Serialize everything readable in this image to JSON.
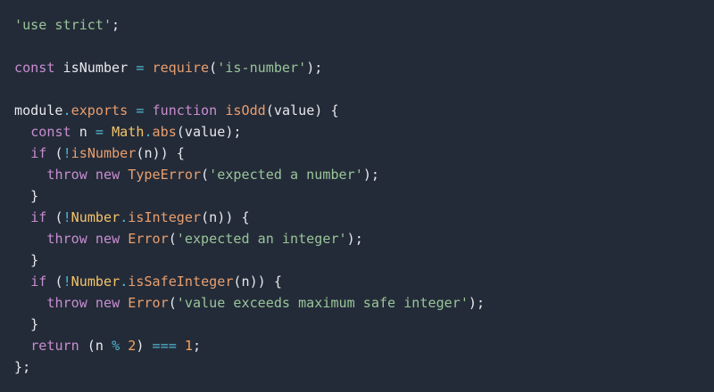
{
  "editor": {
    "colors": {
      "background": "#242b38",
      "plain": "#e6e8ec",
      "keyword": "#c78dd1",
      "string": "#98c59a",
      "function": "#e99f6e",
      "class": "#f2c46b",
      "operator": "#4fb6d2",
      "number": "#f2a35e",
      "property": "#e99f6e"
    },
    "lines": [
      [
        {
          "t": "str",
          "v": "'use strict'"
        },
        {
          "t": "plain",
          "v": ";"
        }
      ],
      [],
      [
        {
          "t": "kw",
          "v": "const"
        },
        {
          "t": "plain",
          "v": " isNumber "
        },
        {
          "t": "op",
          "v": "="
        },
        {
          "t": "plain",
          "v": " "
        },
        {
          "t": "fn",
          "v": "require"
        },
        {
          "t": "plain",
          "v": "("
        },
        {
          "t": "str",
          "v": "'is-number'"
        },
        {
          "t": "plain",
          "v": ");"
        }
      ],
      [],
      [
        {
          "t": "plain",
          "v": "module"
        },
        {
          "t": "op",
          "v": "."
        },
        {
          "t": "prop",
          "v": "exports"
        },
        {
          "t": "plain",
          "v": " "
        },
        {
          "t": "op",
          "v": "="
        },
        {
          "t": "plain",
          "v": " "
        },
        {
          "t": "kw",
          "v": "function"
        },
        {
          "t": "plain",
          "v": " "
        },
        {
          "t": "fn",
          "v": "isOdd"
        },
        {
          "t": "plain",
          "v": "(value) {"
        }
      ],
      [
        {
          "t": "plain",
          "v": "  "
        },
        {
          "t": "kw",
          "v": "const"
        },
        {
          "t": "plain",
          "v": " n "
        },
        {
          "t": "op",
          "v": "="
        },
        {
          "t": "plain",
          "v": " "
        },
        {
          "t": "cls",
          "v": "Math"
        },
        {
          "t": "op",
          "v": "."
        },
        {
          "t": "fn",
          "v": "abs"
        },
        {
          "t": "plain",
          "v": "(value);"
        }
      ],
      [
        {
          "t": "plain",
          "v": "  "
        },
        {
          "t": "kw",
          "v": "if"
        },
        {
          "t": "plain",
          "v": " ("
        },
        {
          "t": "op",
          "v": "!"
        },
        {
          "t": "fn",
          "v": "isNumber"
        },
        {
          "t": "plain",
          "v": "(n)) {"
        }
      ],
      [
        {
          "t": "plain",
          "v": "    "
        },
        {
          "t": "kw",
          "v": "throw"
        },
        {
          "t": "plain",
          "v": " "
        },
        {
          "t": "kw",
          "v": "new"
        },
        {
          "t": "plain",
          "v": " "
        },
        {
          "t": "fn",
          "v": "TypeError"
        },
        {
          "t": "plain",
          "v": "("
        },
        {
          "t": "str",
          "v": "'expected a number'"
        },
        {
          "t": "plain",
          "v": ");"
        }
      ],
      [
        {
          "t": "plain",
          "v": "  }"
        }
      ],
      [
        {
          "t": "plain",
          "v": "  "
        },
        {
          "t": "kw",
          "v": "if"
        },
        {
          "t": "plain",
          "v": " ("
        },
        {
          "t": "op",
          "v": "!"
        },
        {
          "t": "cls",
          "v": "Number"
        },
        {
          "t": "op",
          "v": "."
        },
        {
          "t": "fn",
          "v": "isInteger"
        },
        {
          "t": "plain",
          "v": "(n)) {"
        }
      ],
      [
        {
          "t": "plain",
          "v": "    "
        },
        {
          "t": "kw",
          "v": "throw"
        },
        {
          "t": "plain",
          "v": " "
        },
        {
          "t": "kw",
          "v": "new"
        },
        {
          "t": "plain",
          "v": " "
        },
        {
          "t": "fn",
          "v": "Error"
        },
        {
          "t": "plain",
          "v": "("
        },
        {
          "t": "str",
          "v": "'expected an integer'"
        },
        {
          "t": "plain",
          "v": ");"
        }
      ],
      [
        {
          "t": "plain",
          "v": "  }"
        }
      ],
      [
        {
          "t": "plain",
          "v": "  "
        },
        {
          "t": "kw",
          "v": "if"
        },
        {
          "t": "plain",
          "v": " ("
        },
        {
          "t": "op",
          "v": "!"
        },
        {
          "t": "cls",
          "v": "Number"
        },
        {
          "t": "op",
          "v": "."
        },
        {
          "t": "fn",
          "v": "isSafeInteger"
        },
        {
          "t": "plain",
          "v": "(n)) {"
        }
      ],
      [
        {
          "t": "plain",
          "v": "    "
        },
        {
          "t": "kw",
          "v": "throw"
        },
        {
          "t": "plain",
          "v": " "
        },
        {
          "t": "kw",
          "v": "new"
        },
        {
          "t": "plain",
          "v": " "
        },
        {
          "t": "fn",
          "v": "Error"
        },
        {
          "t": "plain",
          "v": "("
        },
        {
          "t": "str",
          "v": "'value exceeds maximum safe integer'"
        },
        {
          "t": "plain",
          "v": ");"
        }
      ],
      [
        {
          "t": "plain",
          "v": "  }"
        }
      ],
      [
        {
          "t": "plain",
          "v": "  "
        },
        {
          "t": "kw",
          "v": "return"
        },
        {
          "t": "plain",
          "v": " (n "
        },
        {
          "t": "op",
          "v": "%"
        },
        {
          "t": "plain",
          "v": " "
        },
        {
          "t": "num",
          "v": "2"
        },
        {
          "t": "plain",
          "v": ") "
        },
        {
          "t": "op",
          "v": "==="
        },
        {
          "t": "plain",
          "v": " "
        },
        {
          "t": "num",
          "v": "1"
        },
        {
          "t": "plain",
          "v": ";"
        }
      ],
      [
        {
          "t": "plain",
          "v": "};"
        }
      ]
    ]
  }
}
